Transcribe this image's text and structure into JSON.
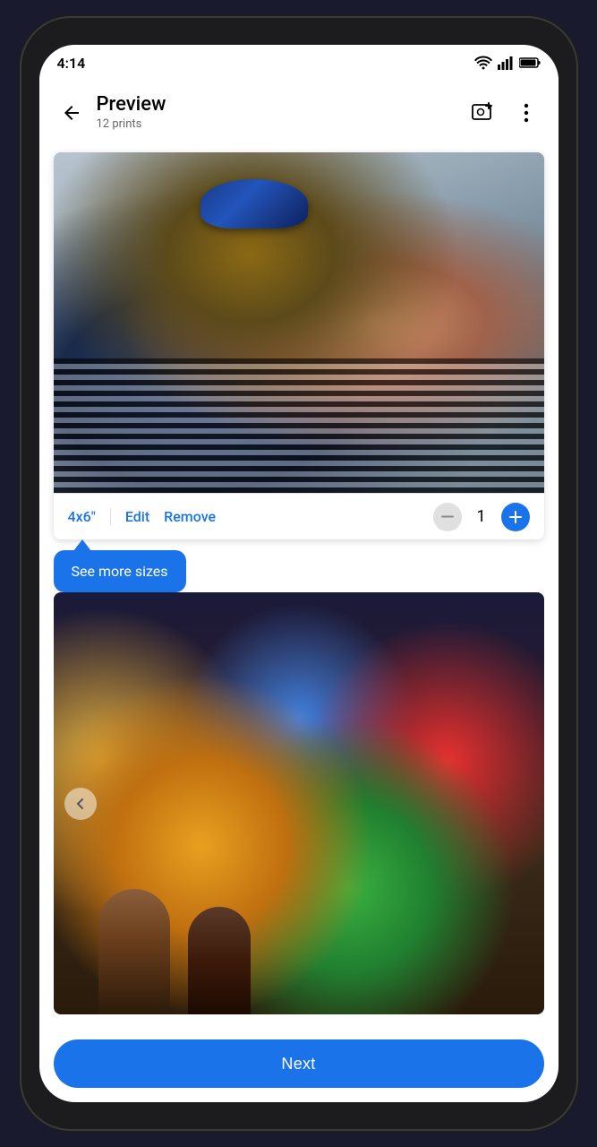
{
  "statusBar": {
    "time": "4:14",
    "wifiLabel": "wifi",
    "signalLabel": "signal",
    "batteryLabel": "battery"
  },
  "header": {
    "backLabel": "back",
    "title": "Preview",
    "subtitle": "12 prints",
    "addPhotoLabel": "add-photo",
    "moreLabel": "more-options"
  },
  "photoCard": {
    "sizeLabel": "4x6\"",
    "editLabel": "Edit",
    "removeLabel": "Remove",
    "quantity": "1"
  },
  "tooltip": {
    "text": "See more sizes"
  },
  "nextButton": {
    "label": "Next"
  }
}
